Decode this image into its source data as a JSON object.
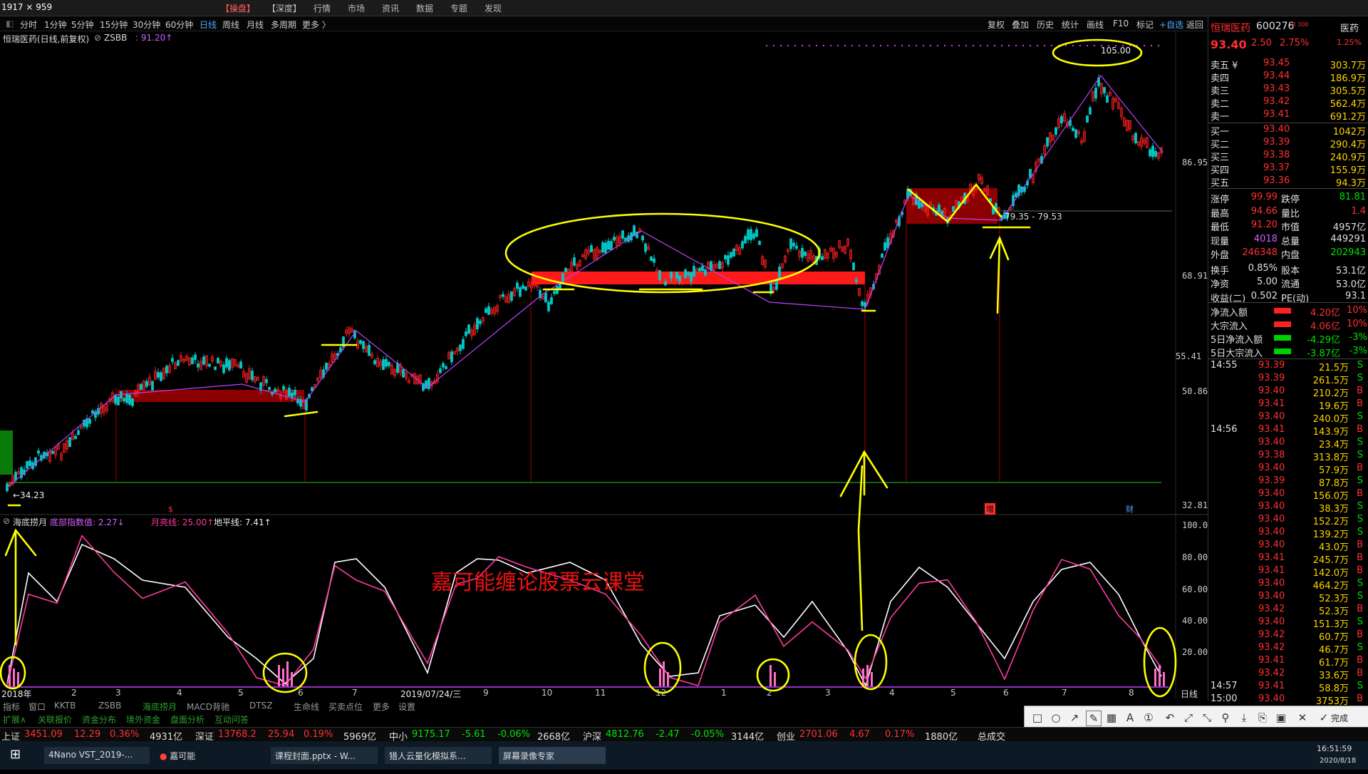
{
  "window": {
    "size_label": "1917 × 959"
  },
  "top_menu": [
    "【操盘】",
    "【深度】",
    "行情",
    "市场",
    "资讯",
    "数据",
    "专题",
    "发现"
  ],
  "period_tabs": [
    "分时",
    "1分钟",
    "5分钟",
    "15分钟",
    "30分钟",
    "60分钟",
    "日线",
    "周线",
    "月线",
    "多周期",
    "更多 〉"
  ],
  "active_period": "日线",
  "toolbar_right": [
    "复权",
    "叠加",
    "历史",
    "统计",
    "画线",
    "F10",
    "标记",
    "+自选",
    "返回"
  ],
  "chart": {
    "header_title": "恒瑞医药(日线,前复权)",
    "indicator_name": "ZSBB",
    "indicator_value": ": 91.20↑",
    "price_axis": [
      "86.95",
      "68.91",
      "55.41",
      "50.86",
      "32.81"
    ],
    "low_marker": "←34.23",
    "high_marker": "105.00",
    "range_label": "79.35 - 79.53",
    "sub_indicator_name": "海底捞月",
    "sub_indicator_vals": [
      "底部指数值: 2.27↓",
      "月亮线: 25.00↑",
      "地平线: 7.41↑"
    ],
    "sub_axis": [
      "100.0",
      "80.00",
      "60.00",
      "40.00",
      "20.00"
    ],
    "watermark": "嘉可能缠论股票云课堂",
    "x_labels": [
      "2018年",
      "2",
      "3",
      "4",
      "5",
      "6",
      "7",
      "2019/07/24/三",
      "9",
      "10",
      "11",
      "12",
      "1",
      "2",
      "3",
      "4",
      "5",
      "6",
      "7",
      "8"
    ],
    "x_right_label": "日线",
    "event_markers": [
      "$",
      "增",
      "财"
    ]
  },
  "quote": {
    "name": "恒瑞医药",
    "code": "600276",
    "code_tag": "R 300",
    "sector": "医药",
    "price": "93.40",
    "change": "2.50",
    "change_pct": "2.75%",
    "amp": "1.25%",
    "sell": [
      {
        "label": "卖五 ¥",
        "price": "93.45",
        "vol": "303.7万"
      },
      {
        "label": "卖四",
        "price": "93.44",
        "vol": "186.9万"
      },
      {
        "label": "卖三",
        "price": "93.43",
        "vol": "305.5万"
      },
      {
        "label": "卖二",
        "price": "93.42",
        "vol": "562.4万"
      },
      {
        "label": "卖一",
        "price": "93.41",
        "vol": "691.2万"
      }
    ],
    "buy": [
      {
        "label": "买一",
        "price": "93.40",
        "vol": "1042万"
      },
      {
        "label": "买二",
        "price": "93.39",
        "vol": "290.4万"
      },
      {
        "label": "买三",
        "price": "93.38",
        "vol": "240.9万"
      },
      {
        "label": "买四",
        "price": "93.37",
        "vol": "155.9万"
      },
      {
        "label": "买五",
        "price": "93.36",
        "vol": "94.3万"
      }
    ],
    "stats": [
      {
        "l1": "涨停",
        "v1": "99.99",
        "l2": "跌停",
        "v2": "81.81"
      },
      {
        "l1": "最高",
        "v1": "94.66",
        "l2": "量比",
        "v2": "1.4"
      },
      {
        "l1": "最低",
        "v1": "91.20",
        "l2": "市值",
        "v2": "4957亿"
      },
      {
        "l1": "现量",
        "v1": "4018",
        "l2": "总量",
        "v2": "449291"
      },
      {
        "l1": "外盘",
        "v1": "246348",
        "l2": "内盘",
        "v2": "202943"
      },
      {
        "l1": "换手",
        "v1": "0.85%",
        "l2": "股本",
        "v2": "53.1亿"
      },
      {
        "l1": "净资",
        "v1": "5.00",
        "l2": "流通",
        "v2": "53.0亿"
      },
      {
        "l1": "收益(二)",
        "v1": "0.502",
        "l2": "PE(动)",
        "v2": "93.1"
      }
    ],
    "flows": [
      {
        "label": "净流入额",
        "value": "4.20亿",
        "pct": "10%"
      },
      {
        "label": "大宗流入",
        "value": "4.06亿",
        "pct": "10%"
      },
      {
        "label": "5日净流入额",
        "value": "-4.29亿",
        "pct": "-3%"
      },
      {
        "label": "5日大宗流入",
        "value": "-3.87亿",
        "pct": "-3%"
      }
    ],
    "ticks": [
      {
        "t": "14:55",
        "p": "93.39",
        "v": "21.5万",
        "s": "S"
      },
      {
        "t": "",
        "p": "93.39",
        "v": "261.5万",
        "s": "S"
      },
      {
        "t": "",
        "p": "93.40",
        "v": "210.2万",
        "s": "B"
      },
      {
        "t": "",
        "p": "93.41",
        "v": "19.6万",
        "s": "B"
      },
      {
        "t": "",
        "p": "93.40",
        "v": "240.0万",
        "s": "S"
      },
      {
        "t": "14:56",
        "p": "93.41",
        "v": "143.9万",
        "s": "B"
      },
      {
        "t": "",
        "p": "93.40",
        "v": "23.4万",
        "s": "S"
      },
      {
        "t": "",
        "p": "93.38",
        "v": "313.8万",
        "s": "S"
      },
      {
        "t": "",
        "p": "93.40",
        "v": "57.9万",
        "s": "B"
      },
      {
        "t": "",
        "p": "93.39",
        "v": "87.8万",
        "s": "S"
      },
      {
        "t": "",
        "p": "93.40",
        "v": "156.0万",
        "s": "B"
      },
      {
        "t": "",
        "p": "93.40",
        "v": "38.3万",
        "s": "S"
      },
      {
        "t": "",
        "p": "93.40",
        "v": "152.2万",
        "s": "S"
      },
      {
        "t": "",
        "p": "93.40",
        "v": "139.2万",
        "s": "S"
      },
      {
        "t": "",
        "p": "93.40",
        "v": "43.0万",
        "s": "B"
      },
      {
        "t": "",
        "p": "93.41",
        "v": "245.7万",
        "s": "B"
      },
      {
        "t": "",
        "p": "93.41",
        "v": "142.0万",
        "s": "B"
      },
      {
        "t": "",
        "p": "93.40",
        "v": "464.2万",
        "s": "S"
      },
      {
        "t": "",
        "p": "93.40",
        "v": "52.3万",
        "s": "S"
      },
      {
        "t": "",
        "p": "93.42",
        "v": "52.3万",
        "s": "B"
      },
      {
        "t": "",
        "p": "93.40",
        "v": "151.3万",
        "s": "S"
      },
      {
        "t": "",
        "p": "93.42",
        "v": "60.7万",
        "s": "B"
      },
      {
        "t": "",
        "p": "93.42",
        "v": "46.7万",
        "s": "S"
      },
      {
        "t": "",
        "p": "93.41",
        "v": "61.7万",
        "s": "B"
      },
      {
        "t": "",
        "p": "93.42",
        "v": "33.6万",
        "s": "B"
      },
      {
        "t": "14:57",
        "p": "93.41",
        "v": "58.8万",
        "s": "S"
      },
      {
        "t": "15:00",
        "p": "93.40",
        "v": "3753万",
        "s": "B"
      }
    ]
  },
  "bottom_tabs": [
    "指标",
    "窗口",
    "KKTB",
    "ZSBB",
    "海底捞月",
    "MACD背驰",
    "DTSZ",
    "生命线",
    "买卖点位",
    "更多",
    "设置"
  ],
  "bottom_tabs2": [
    "扩展∧",
    "关联报价",
    "资金分布",
    "境外资金",
    "盘面分析",
    "互动问答"
  ],
  "index_bar": [
    {
      "name": "上证",
      "val": "3451.09",
      "chg": "12.29",
      "pct": "0.36%",
      "amt": "4931亿"
    },
    {
      "name": "深证",
      "val": "13768.2",
      "chg": "25.94",
      "pct": "0.19%",
      "amt": "5969亿"
    },
    {
      "name": "中小",
      "val": "9175.17",
      "chg": "-5.61",
      "pct": "-0.06%",
      "amt": "2668亿"
    },
    {
      "name": "沪深",
      "val": "4812.76",
      "chg": "-2.47",
      "pct": "-0.05%",
      "amt": "3144亿"
    },
    {
      "name": "创业",
      "val": "2701.06",
      "chg": "4.67",
      "pct": "0.17%",
      "amt": "1880亿"
    }
  ],
  "index_tail": "总成交",
  "draw_tools": {
    "done_label": "完成"
  },
  "taskbar": {
    "items": [
      "4Nano VST_2019-...",
      "嘉可能",
      "课程封面.pptx - W...",
      "猎人云量化模拟系...",
      "屏幕录像专家"
    ],
    "time": "16:51:59",
    "date": "2020/8/18"
  },
  "colors": {
    "up": "#ff2020",
    "down": "#00c8c8",
    "highlight": "#ffff00",
    "box": "#8b0000",
    "accent_purple": "#d060ff"
  }
}
